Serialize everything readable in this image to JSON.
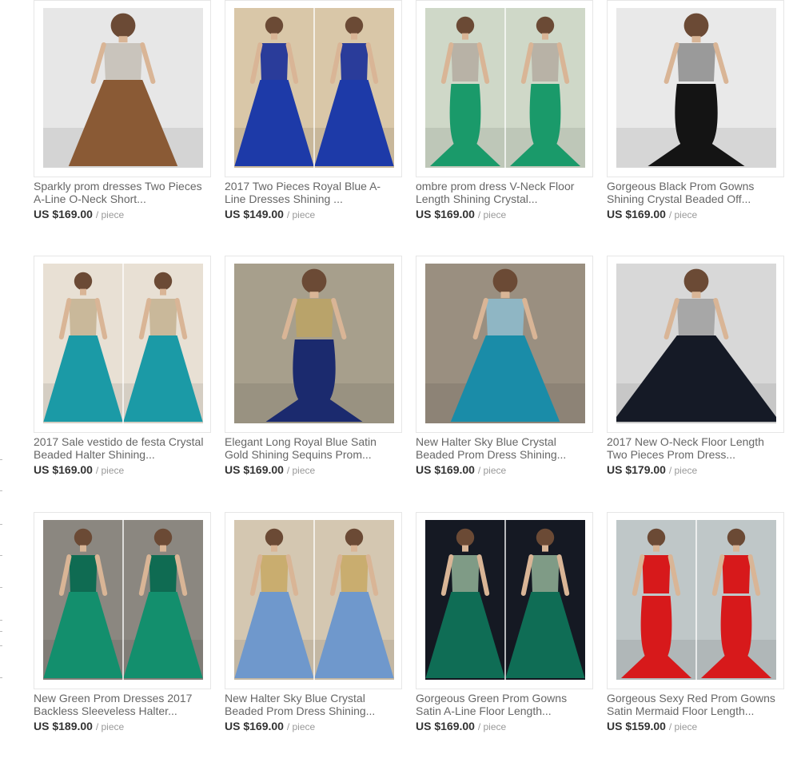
{
  "products": [
    {
      "title_line1": "Sparkly prom dresses Two Pieces",
      "title_line2": "A-Line O-Neck Short...",
      "price": "US $169.00",
      "unit": "/ piece",
      "image": "dress-brown-two-piece",
      "bg": "#e7e7e7",
      "dress": "#8a5a35",
      "bodice": "#c9c4bc",
      "style": "aline",
      "split": false
    },
    {
      "title_line1": "2017 Two Pieces Royal Blue A-",
      "title_line2": "Line Dresses Shining ...",
      "price": "US $149.00",
      "unit": "/ piece",
      "image": "dress-royal-blue-two-piece",
      "bg": "#d9c7a8",
      "dress": "#1d3aa8",
      "bodice": "#2a3c9a",
      "style": "aline",
      "split": true
    },
    {
      "title_line1": "ombre prom dress V-Neck Floor",
      "title_line2": "Length Shining Crystal...",
      "price": "US $169.00",
      "unit": "/ piece",
      "image": "dress-green-mermaid",
      "bg": "#cfd8c8",
      "dress": "#1a9a6a",
      "bodice": "#b8b2a6",
      "style": "mermaid",
      "split": true
    },
    {
      "title_line1": "Gorgeous Black Prom Gowns",
      "title_line2": "Shining Crystal Beaded Off...",
      "price": "US $169.00",
      "unit": "/ piece",
      "image": "dress-black-mermaid",
      "bg": "#e9e9e9",
      "dress": "#141414",
      "bodice": "#9a9a9a",
      "style": "mermaid",
      "split": false
    },
    {
      "title_line1": "2017 Sale vestido de festa Crystal",
      "title_line2": "Beaded Halter Shining...",
      "price": "US $169.00",
      "unit": "/ piece",
      "image": "dress-teal-halter",
      "bg": "#e8e0d4",
      "dress": "#1b9aa6",
      "bodice": "#c9b89a",
      "style": "aline",
      "split": true
    },
    {
      "title_line1": "Elegant Long Royal Blue Satin",
      "title_line2": "Gold Shining Sequins Prom...",
      "price": "US $169.00",
      "unit": "/ piece",
      "image": "dress-navy-gold",
      "bg": "#a79f8c",
      "dress": "#1b2a6e",
      "bodice": "#b9a36a",
      "style": "mermaid",
      "split": false
    },
    {
      "title_line1": "New Halter Sky Blue Crystal",
      "title_line2": "Beaded Prom Dress Shining...",
      "price": "US $169.00",
      "unit": "/ piece",
      "image": "dress-teal-couple",
      "bg": "#9a8f80",
      "dress": "#1a8ca8",
      "bodice": "#8fb6c4",
      "style": "aline",
      "split": false
    },
    {
      "title_line1": "2017 New O-Neck Floor Length",
      "title_line2": "Two Pieces Prom Dress...",
      "price": "US $179.00",
      "unit": "/ piece",
      "image": "dress-black-tiered",
      "bg": "#d8d8d8",
      "dress": "#151a26",
      "bodice": "#a7a7a7",
      "style": "ballgown",
      "split": false
    },
    {
      "title_line1": "New Green Prom Dresses 2017",
      "title_line2": "Backless Sleeveless Halter...",
      "price": "US $189.00",
      "unit": "/ piece",
      "image": "dress-emerald-halter",
      "bg": "#8b8780",
      "dress": "#138f6d",
      "bodice": "#0f6b52",
      "style": "aline",
      "split": true
    },
    {
      "title_line1": "New Halter Sky Blue Crystal",
      "title_line2": "Beaded Prom Dress Shining...",
      "price": "US $169.00",
      "unit": "/ piece",
      "image": "dress-sky-blue-gold",
      "bg": "#d4c7b1",
      "dress": "#6f98cc",
      "bodice": "#c9ad6f",
      "style": "aline",
      "split": true
    },
    {
      "title_line1": "Gorgeous Green Prom Gowns",
      "title_line2": "Satin A-Line Floor Length...",
      "price": "US $169.00",
      "unit": "/ piece",
      "image": "dress-green-aline",
      "bg": "#151923",
      "dress": "#0f6d55",
      "bodice": "#7f9b86",
      "style": "aline",
      "split": true
    },
    {
      "title_line1": "Gorgeous Sexy Red Prom Gowns",
      "title_line2": "Satin Mermaid Floor Length...",
      "price": "US $159.00",
      "unit": "/ piece",
      "image": "dress-red-mermaid",
      "bg": "#bfc7c8",
      "dress": "#d7191b",
      "bodice": "#d7191b",
      "style": "mermaid",
      "split": true
    }
  ]
}
